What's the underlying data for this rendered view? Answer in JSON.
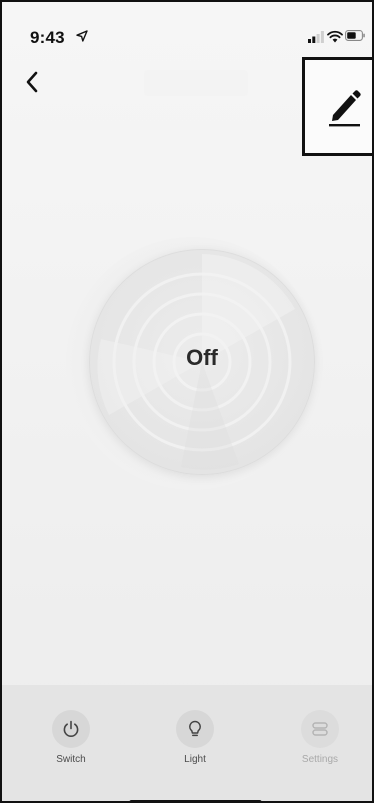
{
  "status_bar": {
    "time": "9:43",
    "icons": [
      "location-arrow-icon",
      "signal-icon",
      "wifi-icon",
      "battery-icon"
    ]
  },
  "nav": {
    "back_icon": "chevron-left-icon",
    "edit_icon": "pencil-icon"
  },
  "power_toggle": {
    "state_label": "Off"
  },
  "tabs": [
    {
      "label": "Switch",
      "icon": "power-icon",
      "enabled": true
    },
    {
      "label": "Light",
      "icon": "lightbulb-icon",
      "enabled": true
    },
    {
      "label": "Settings",
      "icon": "settings-icon",
      "enabled": false
    }
  ],
  "colors": {
    "background": "#f2f2f2",
    "tab_bar": "#e4e4e4",
    "text_primary": "#2a2a2a",
    "text_disabled": "#a9a9a9"
  }
}
